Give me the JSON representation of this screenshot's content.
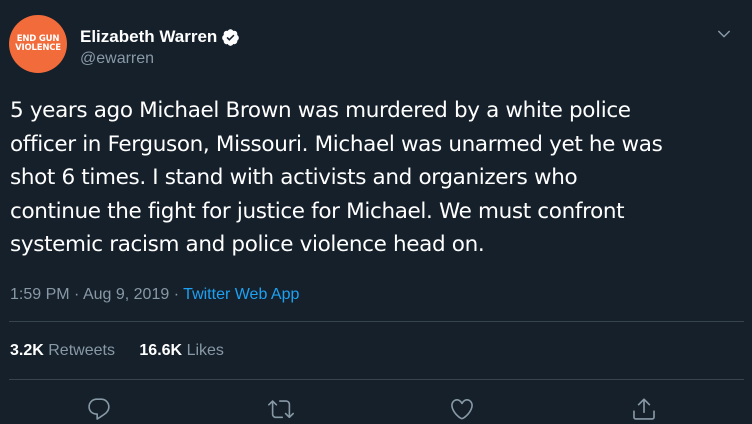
{
  "author": {
    "avatar_lines": [
      "END GUN",
      "VIOLENCE"
    ],
    "display_name": "Elizabeth Warren",
    "handle": "@ewarren",
    "verified": true
  },
  "tweet": {
    "text_lines": [
      "5 years ago Michael Brown was murdered by a white police",
      "officer in Ferguson, Missouri. Michael was unarmed yet he was",
      "shot 6 times. I stand with activists and organizers who",
      "continue the fight for justice for Michael. We must confront",
      "systemic racism and police violence head on."
    ],
    "time": "1:59 PM",
    "date": "Aug 9, 2019",
    "separator": "·",
    "source": "Twitter Web App"
  },
  "stats": {
    "retweets_count": "3.2K",
    "retweets_label": "Retweets",
    "likes_count": "16.6K",
    "likes_label": "Likes"
  },
  "actions": [
    "reply-icon",
    "retweet-icon",
    "like-icon",
    "share-icon"
  ],
  "colors": {
    "background": "#15202b",
    "secondary_text": "#8899a6",
    "link": "#1da1f2",
    "avatar": "#f26b3a",
    "divider": "#38444d"
  }
}
